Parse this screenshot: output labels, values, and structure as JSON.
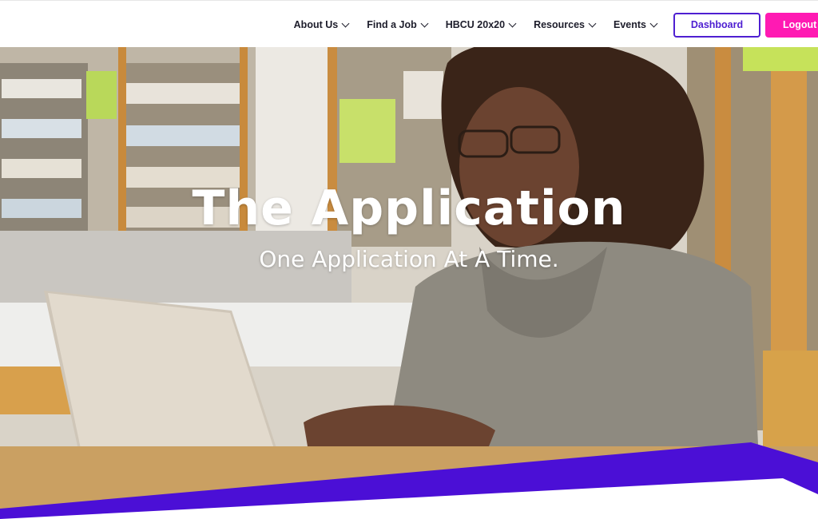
{
  "nav": {
    "items": [
      {
        "label": "About Us"
      },
      {
        "label": "Find a Job"
      },
      {
        "label": "HBCU 20x20"
      },
      {
        "label": "Resources"
      },
      {
        "label": "Events"
      }
    ],
    "dashboard_label": "Dashboard",
    "logout_label": "Logout"
  },
  "hero": {
    "title": "The Application",
    "subtitle": "One Application At A Time.",
    "image": "woman typing on laptop in library"
  },
  "colors": {
    "brand_purple": "#4e1fd1",
    "brand_pink": "#ff1ab3",
    "nav_text": "#1d1d2b"
  }
}
